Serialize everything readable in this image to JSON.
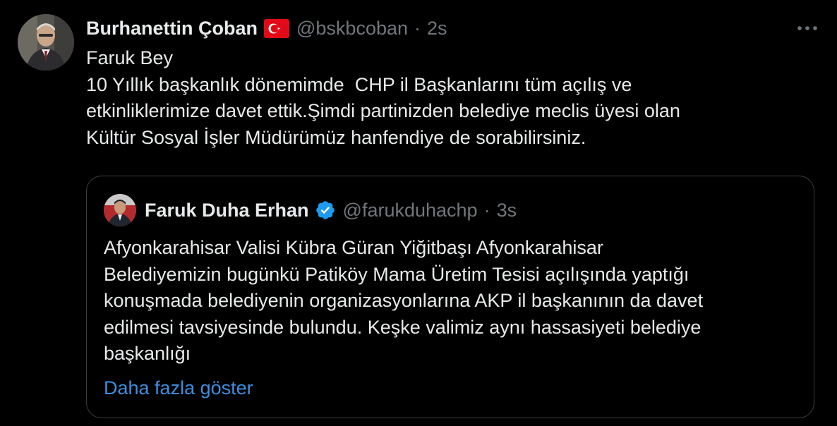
{
  "tweet": {
    "author_name": "Burhanettin Çoban",
    "flag_icon": "turkey-flag-icon",
    "handle": "@bskbcoban",
    "separator": "·",
    "time": "2s",
    "more_icon": "more-icon",
    "text": "Faruk Bey\n10 Yıllık başkanlık dönemimde  CHP il Başkanlarını tüm açılış ve\netkinliklerimize davet ettik.Şimdi partinizden belediye meclis üyesi olan\nKültür Sosyal İşler Müdürümüz hanfendiye de sorabilirsiniz."
  },
  "quote": {
    "author_name": "Faruk Duha Erhan",
    "verified_icon": "verified-badge-icon",
    "handle": "@farukduhachp",
    "separator": "·",
    "time": "3s",
    "text": "Afyonkarahisar Valisi Kübra Güran Yiğitbaşı Afyonkarahisar\nBelediyemizin bugünkü Patiköy Mama Üretim Tesisi açılışında yaptığı\nkonuşmada belediyenin organizasyonlarına AKP il başkanının da davet\nedilmesi tavsiyesinde bulundu. Keşke valimiz aynı hassasiyeti belediye\nbaşkanlığı",
    "show_more": "Daha fazla göster"
  },
  "colors": {
    "background": "#000000",
    "text_primary": "#e7e9ea",
    "text_secondary": "#71767b",
    "link": "#3d8ee0",
    "verified": "#1d9bf0",
    "border": "#3a3d41"
  }
}
